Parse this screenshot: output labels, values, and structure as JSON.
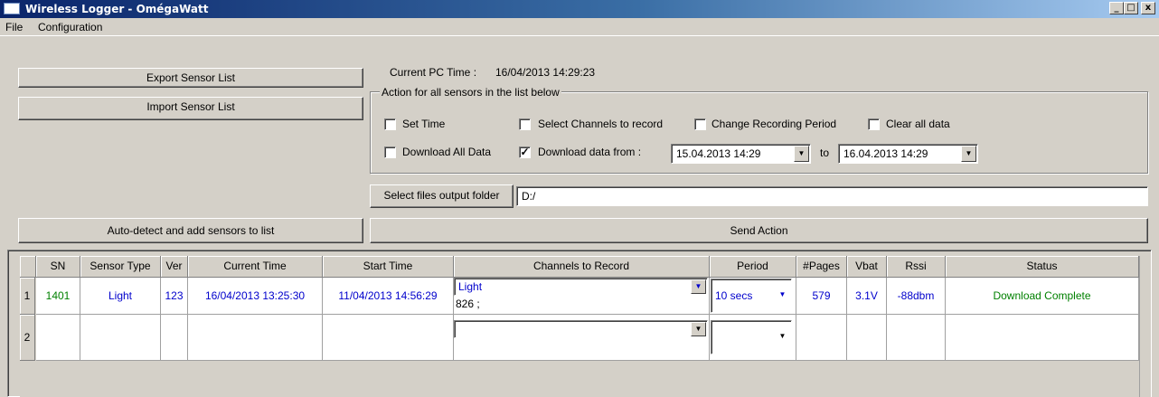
{
  "window": {
    "title": "Wireless Logger - OmégaWatt",
    "minimize": "_",
    "maximize": "□",
    "close": "x"
  },
  "menu": [
    "File",
    "Configuration"
  ],
  "buttons": {
    "export": "Export Sensor List",
    "import": "Import Sensor List",
    "autodetect": "Auto-detect and add sensors to list",
    "send_action": "Send Action",
    "select_folder": "Select files output folder"
  },
  "pc_time": {
    "label": "Current PC Time :",
    "value": "16/04/2013 14:29:23"
  },
  "actions": {
    "legend": "Action for all sensors in the list below",
    "set_time": {
      "label": "Set Time",
      "checked": false
    },
    "select_channels": {
      "label": "Select Channels to record",
      "checked": false
    },
    "change_period": {
      "label": "Change Recording Period",
      "checked": false
    },
    "clear_data": {
      "label": "Clear all data",
      "checked": false
    },
    "download_all": {
      "label": "Download All Data",
      "checked": false
    },
    "download_from": {
      "label": "Download data from :",
      "checked": true
    },
    "from_date": "15.04.2013  14:29",
    "to_label": "to",
    "to_date": "16.04.2013  14:29"
  },
  "output_folder": "D:/",
  "table": {
    "columns": [
      "SN",
      "Sensor Type",
      "Ver",
      "Current Time",
      "Start Time",
      "Channels to Record",
      "Period",
      "#Pages",
      "Vbat",
      "Rssi",
      "Status"
    ],
    "rows": [
      {
        "num": "1",
        "sn": "1401",
        "type": "Light",
        "ver": "123",
        "current_time": "16/04/2013 13:25:30",
        "start_time": "11/04/2013 14:56:29",
        "channel": "Light",
        "channel_detail": "826 ;",
        "period": "10 secs",
        "pages": "579",
        "vbat": "3.1V",
        "rssi": "-88dbm",
        "status": "Download Complete"
      },
      {
        "num": "2",
        "sn": "",
        "type": "",
        "ver": "",
        "current_time": "",
        "start_time": "",
        "channel": "",
        "channel_detail": "",
        "period": "",
        "pages": "",
        "vbat": "",
        "rssi": "",
        "status": ""
      }
    ]
  },
  "icons": {
    "dropdown": "▼",
    "check": "✓"
  },
  "colors": {
    "green": "#008000",
    "blue": "#0000cc",
    "title_start": "#0a246a"
  }
}
